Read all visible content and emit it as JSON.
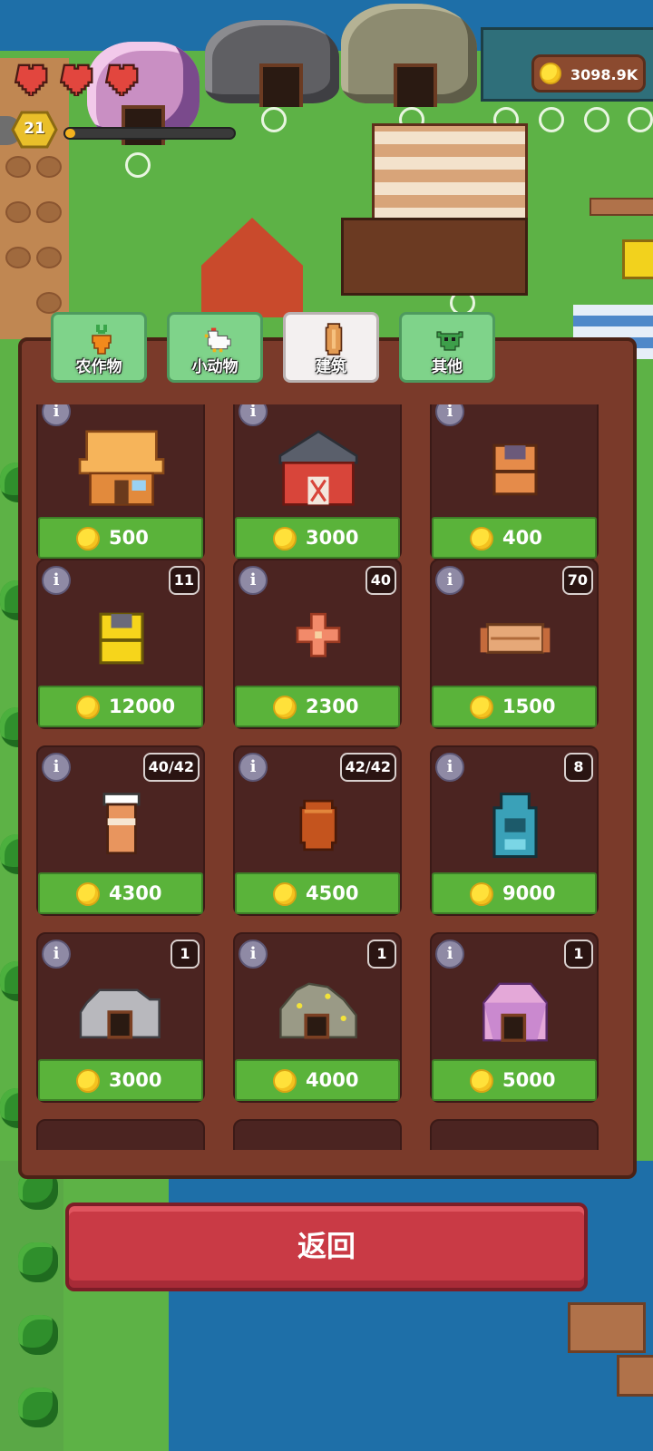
{
  "hud": {
    "coin_balance": "3098.9K",
    "player_level": "21",
    "xp_fraction": 0.06,
    "hearts": 3
  },
  "tabs": [
    {
      "label": "农作物",
      "icon": "carrot-icon",
      "active": false
    },
    {
      "label": "小动物",
      "icon": "chicken-icon",
      "active": false
    },
    {
      "label": "建筑",
      "icon": "building-icon",
      "active": true
    },
    {
      "label": "其他",
      "icon": "goblin-icon",
      "active": false
    }
  ],
  "shop_items": [
    {
      "name": "thatched-house",
      "count": "",
      "price": "500"
    },
    {
      "name": "red-barn",
      "count": "",
      "price": "3000"
    },
    {
      "name": "orange-storage-box",
      "count": "",
      "price": "400"
    },
    {
      "name": "yellow-storage-box",
      "count": "11",
      "price": "12000"
    },
    {
      "name": "flower-decoration",
      "count": "40",
      "price": "2300"
    },
    {
      "name": "wooden-bench",
      "count": "70",
      "price": "1500"
    },
    {
      "name": "beehive",
      "count": "40/42",
      "price": "4300"
    },
    {
      "name": "wooden-barrel",
      "count": "42/42",
      "price": "4500"
    },
    {
      "name": "blue-machine",
      "count": "8",
      "price": "9000"
    },
    {
      "name": "stone-mine",
      "count": "1",
      "price": "3000"
    },
    {
      "name": "gold-ore-mine",
      "count": "1",
      "price": "4000"
    },
    {
      "name": "crystal-mine",
      "count": "1",
      "price": "5000"
    }
  ],
  "buttons": {
    "back_label": "返回"
  },
  "colors": {
    "panel": "#7a3a2a",
    "price_button": "#5ab33a",
    "back_button": "#c93a45",
    "tab_inactive": "#7fd38a"
  }
}
